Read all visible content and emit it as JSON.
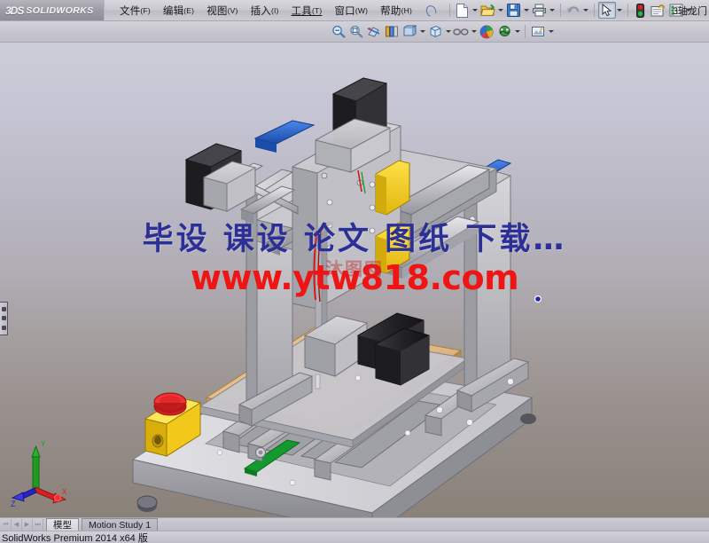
{
  "app": {
    "brand_mark": "3DS",
    "brand_name": "SOLIDWORKS",
    "document_title": "3轴龙门"
  },
  "menu": {
    "items": [
      {
        "label": "文件",
        "mnemonic": "(F)",
        "name": "menu-file"
      },
      {
        "label": "编辑",
        "mnemonic": "(E)",
        "name": "menu-edit"
      },
      {
        "label": "视图",
        "mnemonic": "(V)",
        "name": "menu-view"
      },
      {
        "label": "插入",
        "mnemonic": "(I)",
        "name": "menu-insert"
      },
      {
        "label": "工具",
        "mnemonic": "(T)",
        "name": "menu-tools"
      },
      {
        "label": "窗口",
        "mnemonic": "(W)",
        "name": "menu-window"
      },
      {
        "label": "帮助",
        "mnemonic": "(H)",
        "name": "menu-help"
      }
    ]
  },
  "toolbar_main": {
    "buttons": [
      {
        "icon": "new-document-icon",
        "has_dropdown": true
      },
      {
        "icon": "open-folder-icon",
        "has_dropdown": true
      },
      {
        "icon": "save-icon",
        "has_dropdown": true
      },
      {
        "icon": "print-icon",
        "has_dropdown": true
      },
      {
        "icon": "undo-icon",
        "has_dropdown": true
      },
      {
        "icon": "select-cursor-icon",
        "has_dropdown": true,
        "pressed": true
      },
      {
        "icon": "rebuild-traffic-light-icon",
        "has_dropdown": false
      },
      {
        "icon": "options-gear-icon",
        "has_dropdown": false
      },
      {
        "icon": "properties-list-icon",
        "has_dropdown": true
      }
    ]
  },
  "toolbar_view": {
    "buttons": [
      {
        "icon": "zoom-to-fit-icon",
        "has_dropdown": false
      },
      {
        "icon": "zoom-to-area-icon",
        "has_dropdown": false
      },
      {
        "icon": "section-view-icon",
        "has_dropdown": false
      },
      {
        "icon": "view-orientation-icon",
        "has_dropdown": false
      },
      {
        "icon": "display-style-icon",
        "has_dropdown": true
      },
      {
        "icon": "hide-show-items-icon",
        "has_dropdown": true
      },
      {
        "icon": "edit-appearance-glasses-icon",
        "has_dropdown": true
      },
      {
        "icon": "apply-scene-icon",
        "has_dropdown": false
      },
      {
        "icon": "view-settings-icon",
        "has_dropdown": true
      },
      {
        "icon": "render-tools-icon",
        "has_dropdown": true
      }
    ]
  },
  "viewport": {
    "triad_axes": [
      {
        "label": "Y",
        "color": "#1f9b1f"
      },
      {
        "label": "X",
        "color": "#d82020"
      },
      {
        "label": "Z",
        "color": "#2424c8"
      }
    ],
    "background_top_color": "#cdccd9",
    "background_bottom_color": "#8a8179",
    "flyout_panel": "feature-manager-flyout"
  },
  "watermark": {
    "line_cn": "毕设 课设 论文 图纸 下载…",
    "line_url": "www.ytw818.com",
    "ghost": "沐图网",
    "color_cn": "#2b2f96",
    "color_url": "#f01515"
  },
  "tabs": {
    "nav": [
      "⏮",
      "◀",
      "▶",
      "⏭"
    ],
    "items": [
      {
        "label": "模型",
        "active": true
      },
      {
        "label": "Motion Study 1",
        "active": false
      }
    ]
  },
  "statusbar": {
    "text": "SolidWorks Premium 2014 x64 版"
  },
  "model": {
    "name": "3-axis gantry CNC router assembly",
    "colors": {
      "aluminum": "#b9b9bd",
      "aluminum_light": "#d2d2d6",
      "aluminum_dark": "#8d8d93",
      "motor_black": "#2b2b2e",
      "accent_blue": "#2255c0",
      "accent_yellow": "#f0c417",
      "estop_red": "#d21818",
      "wood": "#e0b887",
      "pcb_green": "#139a2e"
    }
  }
}
